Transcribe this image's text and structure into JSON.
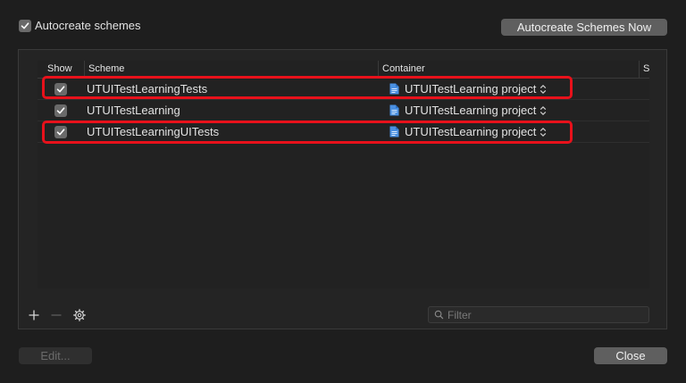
{
  "top": {
    "autocreate_label": "Autocreate schemes",
    "autocreate_checked": true,
    "autocreate_now_label": "Autocreate Schemes Now"
  },
  "table": {
    "columns": [
      "Show",
      "Scheme",
      "Container",
      "S"
    ],
    "rows": [
      {
        "show": true,
        "scheme": "UTUITestLearningTests",
        "container": "UTUITestLearning project",
        "highlighted": true
      },
      {
        "show": true,
        "scheme": "UTUITestLearning",
        "container": "UTUITestLearning project",
        "highlighted": false
      },
      {
        "show": true,
        "scheme": "UTUITestLearningUITests",
        "container": "UTUITestLearning project",
        "highlighted": true
      }
    ]
  },
  "toolbar": {
    "add_icon": "plus-icon",
    "remove_icon": "minus-icon",
    "settings_icon": "gear-icon",
    "filter_placeholder": "Filter",
    "filter_value": ""
  },
  "footer": {
    "edit_label": "Edit...",
    "close_label": "Close"
  },
  "colors": {
    "highlight": "#e8111b",
    "doc_icon": "#4a90e2"
  }
}
